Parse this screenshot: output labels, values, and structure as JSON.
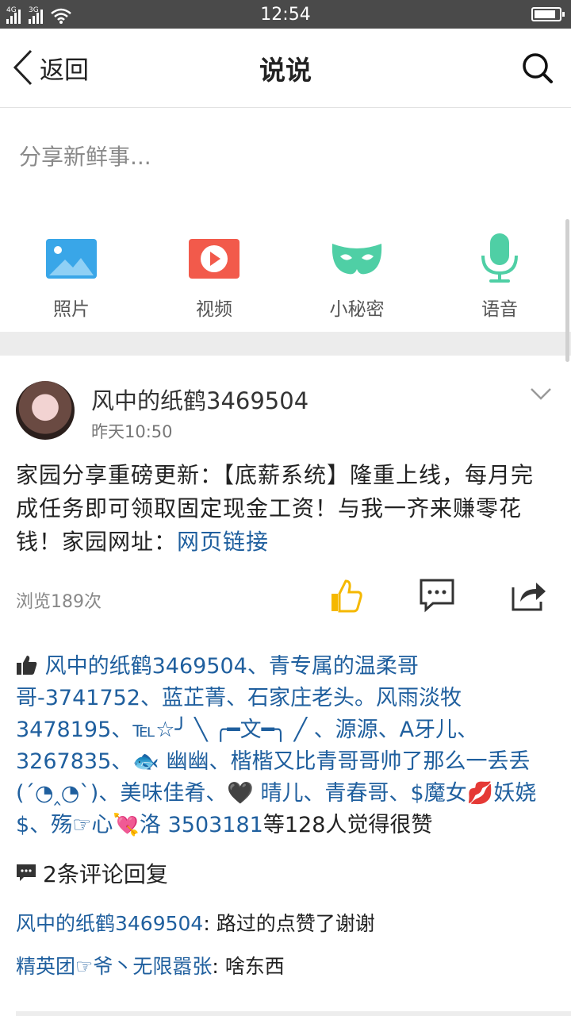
{
  "status": {
    "time": "12:54",
    "sig1": "4G",
    "sig2": "3G"
  },
  "header": {
    "back_label": "返回",
    "title": "说说"
  },
  "compose": {
    "placeholder": "分享新鲜事...",
    "actions": [
      {
        "label": "照片",
        "icon": "photo-icon"
      },
      {
        "label": "视频",
        "icon": "video-icon"
      },
      {
        "label": "小秘密",
        "icon": "mask-icon"
      },
      {
        "label": "语音",
        "icon": "microphone-icon"
      }
    ]
  },
  "post": {
    "author": "风中的纸鹤3469504",
    "time": "昨天10:50",
    "content": "家园分享重磅更新：【底薪系统】隆重上线，每月完成任务即可领取固定现金工资！与我一齐来赚零花钱！家园网址：",
    "link": "网页链接",
    "views": "浏览189次",
    "likes_text": "风中的纸鹤3469504、青专属的温柔哥哥-3741752、蓝芷菁、石家庄老头。风雨淡牧3478195、℡☆╯ ╲ ╭━文━╮ ╱ 、源源、A牙儿、3267835、🐟 幽幽、楷楷又比青哥哥帅了那么一丢丢(´◔‸◔`)、美味佳肴、🖤 晴儿、青春哥、$魔女💋妖娆$、殇☞心💘洛 3503181",
    "likes_suffix": "等128人觉得很赞",
    "comments_header": "2条评论回复",
    "comments": [
      {
        "author": "风中的纸鹤3469504",
        "text": "路过的点赞了谢谢"
      },
      {
        "author": "精英团☞爷丶无限嚣张",
        "text": "啥东西"
      }
    ]
  },
  "colors": {
    "accent_blue": "#1f5f9e",
    "like_yellow": "#f5b800",
    "mask_green": "#4fcfa5",
    "mic_green": "#4fcfa5",
    "photo_blue": "#39a6e8",
    "video_red": "#f25a4b"
  }
}
